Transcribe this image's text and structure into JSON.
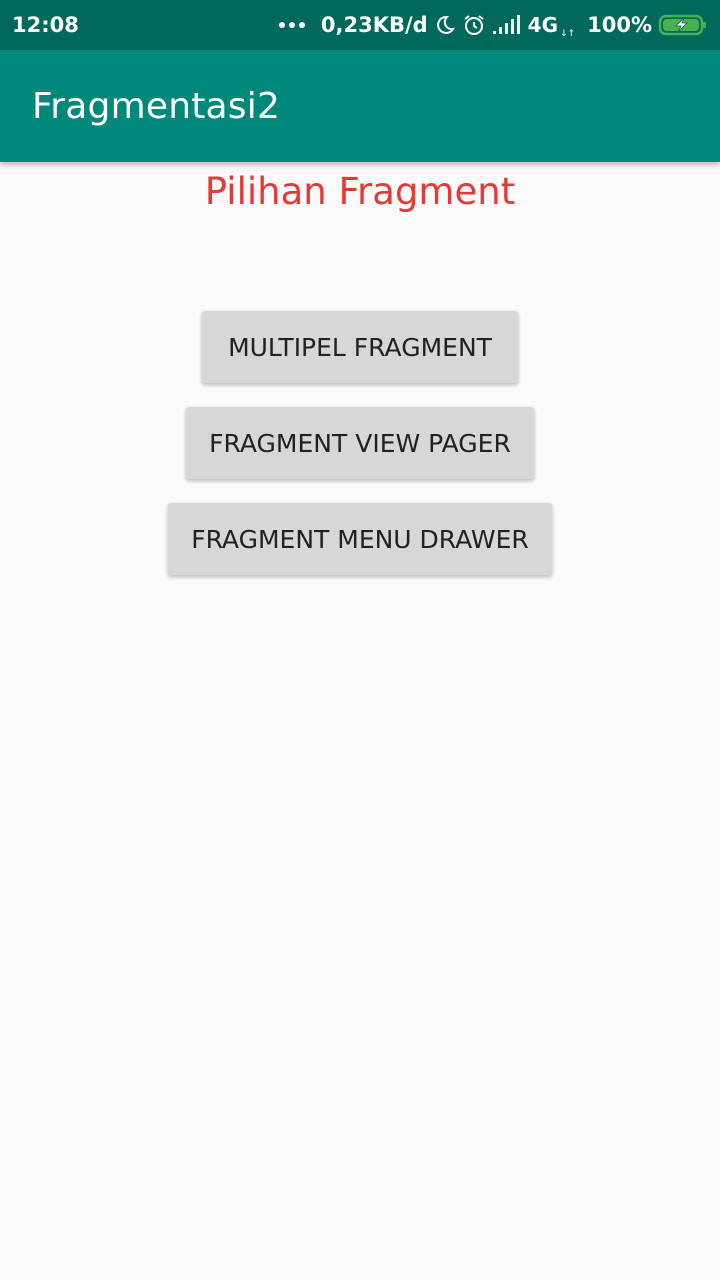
{
  "status_bar": {
    "time": "12:08",
    "net_speed": "0,23KB/d",
    "network": "4G",
    "battery": "100%",
    "icons": [
      "more-dots-icon",
      "moon-icon",
      "alarm-icon",
      "signal-icon",
      "battery-charging-icon"
    ],
    "battery_color": "#4caf50"
  },
  "app_bar": {
    "title": "Fragmentasi2",
    "color": "#00897b"
  },
  "main": {
    "heading": "Pilihan Fragment",
    "heading_color": "#e53935",
    "buttons": [
      {
        "label": "MULTIPEL FRAGMENT"
      },
      {
        "label": "FRAGMENT VIEW PAGER"
      },
      {
        "label": "FRAGMENT MENU DRAWER"
      }
    ]
  }
}
